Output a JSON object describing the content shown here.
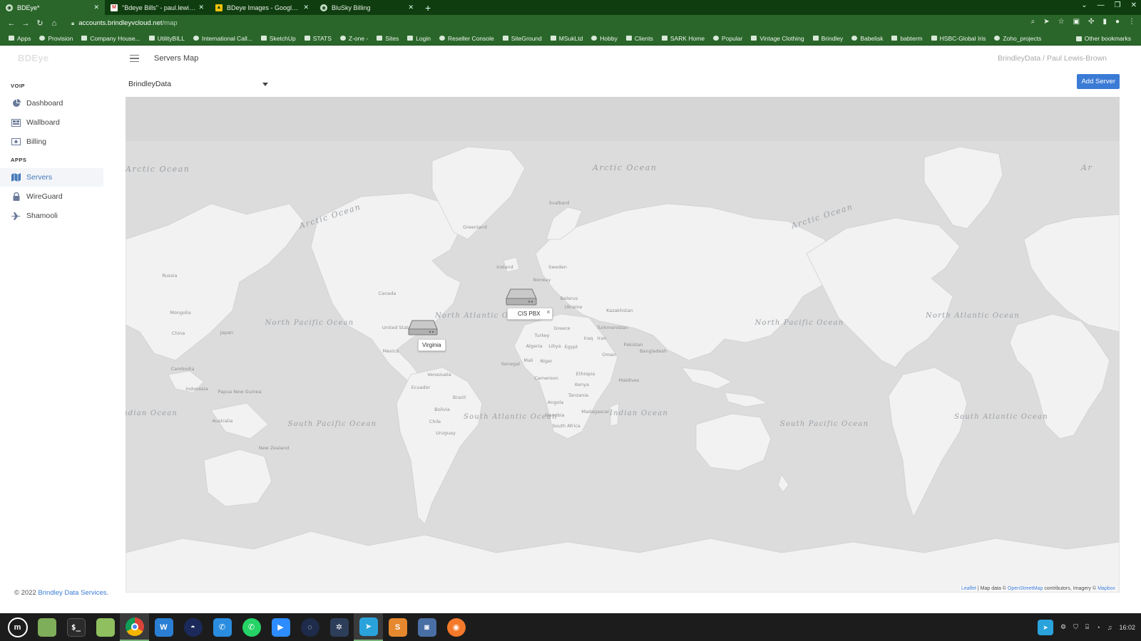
{
  "browser": {
    "tabs": [
      {
        "label": "BDEye*",
        "icon": "globe-icon",
        "active": true
      },
      {
        "label": "\"Bdeye Bills\" - paul.lewisbrow",
        "icon": "gmail-icon",
        "active": false
      },
      {
        "label": "BDeye Images - Google Drive",
        "icon": "drive-icon",
        "active": false
      },
      {
        "label": "BluSky Billing",
        "icon": "globe-icon",
        "active": false
      }
    ],
    "url_host": "accounts.brindleyvcloud.net",
    "url_path": "/map",
    "bookmarks": [
      "Apps",
      "Provision",
      "Company House...",
      "UtilityBILL",
      "International Call...",
      "SketchUp",
      "STATS",
      "Z-one -",
      "Sites",
      "Login",
      "Reseller Console",
      "SiteGround",
      "MSukLtd",
      "Hobby",
      "Clients",
      "SARK Home",
      "Popular",
      "Vintage Clothing",
      "Brindley",
      "Babelisk",
      "babterm",
      "HSBC-Global Iris",
      "Zoho_projects"
    ],
    "other_bookmarks": "Other bookmarks"
  },
  "app": {
    "brand": "BDEye",
    "sections": {
      "voip": "VOIP",
      "apps": "APPS"
    },
    "voip_items": [
      {
        "label": "Dashboard",
        "icon": "dashboard-icon"
      },
      {
        "label": "Wallboard",
        "icon": "wallboard-icon"
      },
      {
        "label": "Billing",
        "icon": "billing-icon"
      }
    ],
    "app_items": [
      {
        "label": "Servers",
        "icon": "map-icon",
        "active": true
      },
      {
        "label": "WireGuard",
        "icon": "lock-icon",
        "active": false
      },
      {
        "label": "Shamooli",
        "icon": "plane-icon",
        "active": false
      }
    ],
    "page_title": "Servers Map",
    "user_path": "BrindleyData / Paul Lewis-Brown",
    "org_select": "BrindleyData",
    "add_server_label": "Add Server",
    "footer_prefix": "© 2022",
    "footer_link": "Brindley Data Services",
    "footer_suffix": "."
  },
  "map": {
    "ocean_labels": [
      "Arctic Ocean",
      "Arctic Ocean",
      "Arctic Ocean",
      "Arctic Ocean",
      "North Pacific Ocean",
      "North Atlantic Ocean",
      "South Pacific Ocean",
      "South Atlantic Ocean",
      "Indian Ocean",
      "Indian Ocean",
      "North Pacific Ocean",
      "North Atlantic Ocean",
      "South Pacific Ocean",
      "South Atlantic Ocean"
    ],
    "country_labels": [
      "Greenland",
      "Canada",
      "United States",
      "Mexico",
      "Venezuela",
      "Brazil",
      "Chile",
      "Uruguay",
      "Russia",
      "Mongolia",
      "China",
      "Japan",
      "Kazakhstan",
      "Turkmenistan",
      "Iran",
      "Iraq",
      "Pakistan",
      "Bangladesh",
      "Cambodia",
      "Indonesia",
      "Papua New Guinea",
      "Australia",
      "New Zealand",
      "Algeria",
      "Libya",
      "Egypt",
      "Mali",
      "Niger",
      "Senegal",
      "Cameroon",
      "Ethiopia",
      "Kenya",
      "Tanzania",
      "Angola",
      "Namibia",
      "South Africa",
      "Madagascar",
      "Iceland",
      "Norway",
      "Sweden",
      "Ukraine",
      "Belarus",
      "Greece",
      "Turkey",
      "Oman",
      "Maldives",
      "Svalbard",
      "Ecuador",
      "Bolivia"
    ],
    "markers": [
      {
        "label": "Virginia",
        "has_close": false
      },
      {
        "label": "CIS PBX",
        "has_close": true
      }
    ],
    "attribution": {
      "leaflet": "Leaflet",
      "mid": " | Map data © ",
      "osm": "OpenStreetMap",
      "mid2": " contributors, Imagery © ",
      "mapbox": "Mapbox"
    }
  },
  "taskbar": {
    "apps": [
      "mint-menu",
      "file-manager",
      "terminal",
      "files",
      "chrome",
      "wps",
      "privacy",
      "phone",
      "whatsapp",
      "zoom",
      "signal",
      "settings",
      "telegram",
      "sublime",
      "screenshot",
      "blender"
    ],
    "clock": "16:02"
  },
  "colors": {
    "chrome_dark": "#0f3d0f",
    "chrome": "#2a662a",
    "accent": "#3a7bd5",
    "map_water": "#dcdcdc",
    "map_land": "#f2f2f2"
  }
}
